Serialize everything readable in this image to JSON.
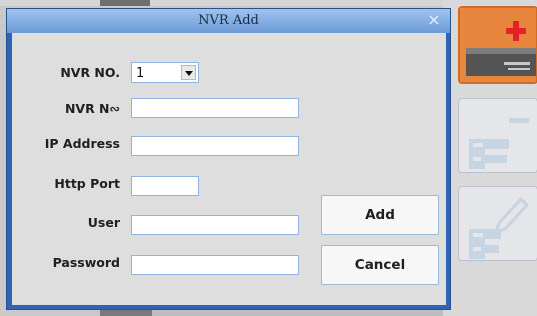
{
  "dialog": {
    "title": "NVR Add",
    "close_glyph": "×",
    "labels": {
      "nvr_no": "NVR NO.",
      "nvr_name": "NVR N∾",
      "ip_address": "IP Address",
      "http_port": "Http Port",
      "user": "User",
      "password": "Password"
    },
    "fields": {
      "nvr_no_selected": "1",
      "nvr_name_value": "",
      "ip_address_value": "",
      "http_port_value": "",
      "user_value": "",
      "password_value": ""
    },
    "buttons": {
      "add": "Add",
      "cancel": "Cancel"
    }
  },
  "toolbar": {
    "icons": [
      "add-nvr-icon",
      "remove-nvr-icon",
      "edit-nvr-icon"
    ],
    "colors": {
      "add_tile": "#e9863d",
      "plus": "#e8202a"
    }
  }
}
